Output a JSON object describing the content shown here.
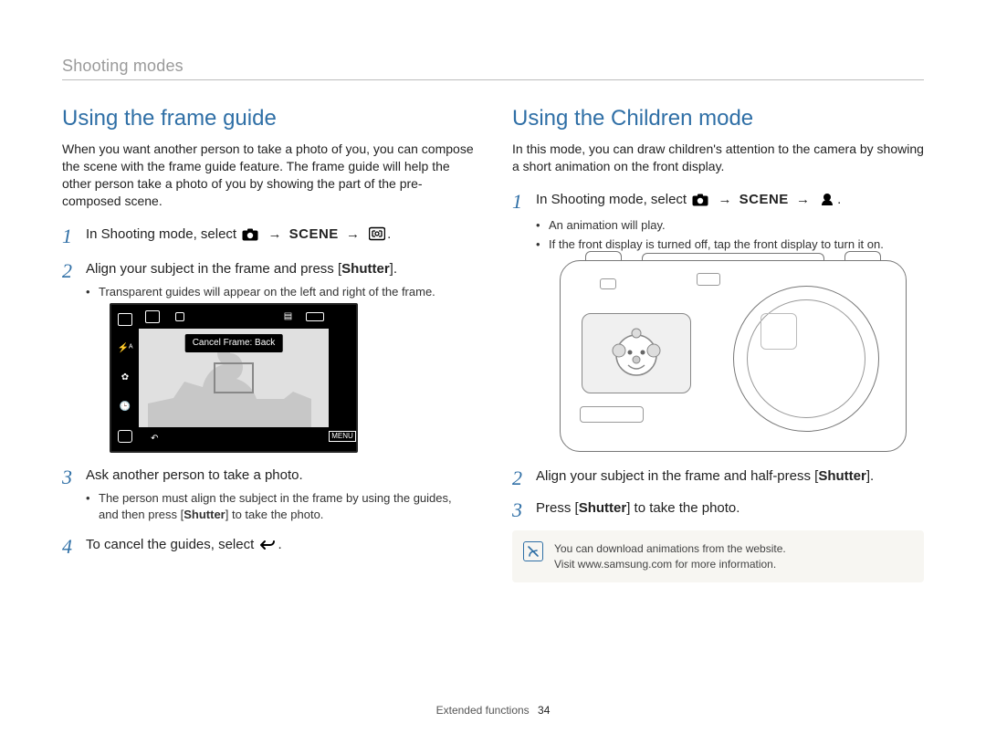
{
  "header": {
    "section": "Shooting modes"
  },
  "left": {
    "title": "Using the frame guide",
    "intro": "When you want another person to take a photo of you, you can compose the scene with the frame guide feature. The frame guide will help the other person take a photo of you by showing the part of the pre-composed scene.",
    "step1_a": "In Shooting mode, select ",
    "arrow": "→",
    "scene": "SCENE",
    "period": ".",
    "step2": "Align your subject in the frame and press [",
    "shutter": "Shutter",
    "step2_end": "].",
    "step2_sub1": "Transparent guides will appear on the left and right of the frame.",
    "lcd_label": "Cancel Frame: Back",
    "step3": "Ask another person to take a photo.",
    "step3_sub1_a": "The person must align the subject in the frame by using the guides, and then press [",
    "step3_sub1_b": "] to take the photo.",
    "step4": "To cancel the guides, select "
  },
  "right": {
    "title": "Using the Children mode",
    "intro": "In this mode, you can draw children's attention to the camera by showing a short animation on the front display.",
    "step1_a": "In Shooting mode, select ",
    "step1_sub1": "An animation will play.",
    "step1_sub2": "If the front display is turned off, tap the front display to turn it on.",
    "step2": "Align your subject in the frame and half-press [",
    "step2_end": "].",
    "step3_a": "Press [",
    "step3_b": "] to take the photo.",
    "note1": "You can download animations from the website.",
    "note2": "Visit www.samsung.com for more information."
  },
  "footer": {
    "label": "Extended functions",
    "page": "34"
  },
  "icons": {
    "camera": "camera-icon",
    "frame_guide": "frame-guide-icon",
    "children": "children-icon",
    "back": "back-icon"
  }
}
